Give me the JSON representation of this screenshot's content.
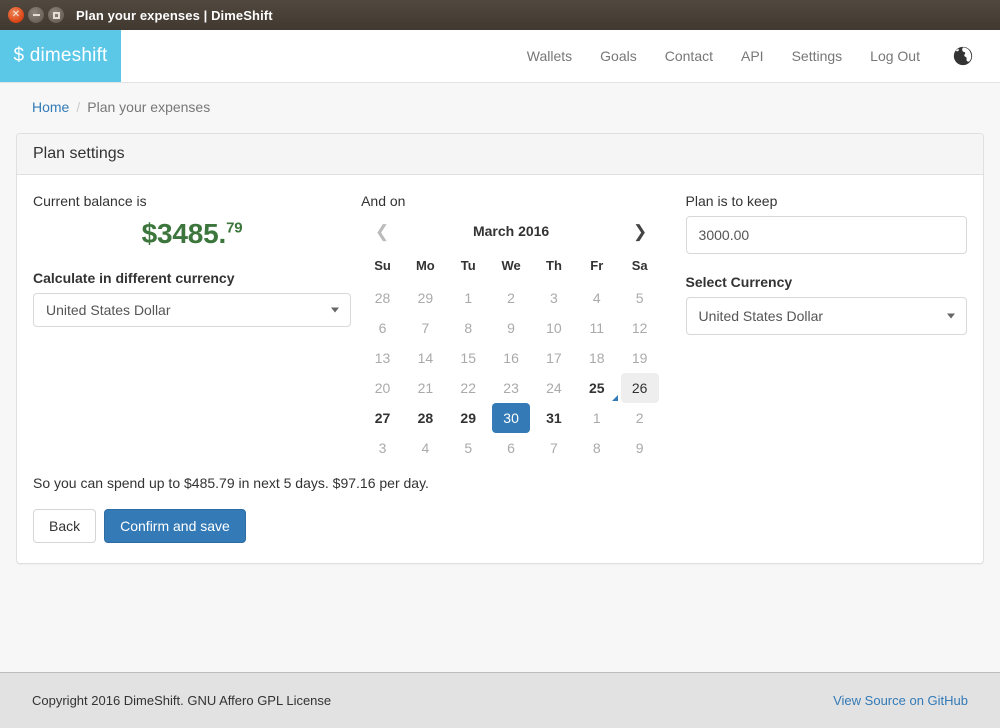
{
  "window": {
    "title": "Plan your expenses | DimeShift",
    "close_icon": "close-icon",
    "minimize_icon": "minimize-icon",
    "maximize-icon": "maximize-icon"
  },
  "navbar": {
    "brand": "$ dimeshift",
    "links": [
      {
        "label": "Wallets"
      },
      {
        "label": "Goals"
      },
      {
        "label": "Contact"
      },
      {
        "label": "API"
      },
      {
        "label": "Settings"
      },
      {
        "label": "Log Out"
      }
    ],
    "globe_icon": "globe-icon"
  },
  "breadcrumb": {
    "home": "Home",
    "separator": "/",
    "current": "Plan your expenses"
  },
  "panel": {
    "heading": "Plan settings",
    "left": {
      "balance_label": "Current balance is",
      "balance_main": "$3485.",
      "balance_cents": "79",
      "currency_label": "Calculate in different currency",
      "currency_value": "United States Dollar"
    },
    "middle": {
      "label": "And on",
      "calendar": {
        "title": "March 2016",
        "prev_icon": "chevron-left-icon",
        "next_icon": "chevron-right-icon",
        "dow": [
          "Su",
          "Mo",
          "Tu",
          "We",
          "Th",
          "Fr",
          "Sa"
        ],
        "weeks": [
          [
            {
              "d": "28",
              "state": "muted"
            },
            {
              "d": "29",
              "state": "muted"
            },
            {
              "d": "1",
              "state": "muted"
            },
            {
              "d": "2",
              "state": "muted"
            },
            {
              "d": "3",
              "state": "muted"
            },
            {
              "d": "4",
              "state": "muted"
            },
            {
              "d": "5",
              "state": "muted"
            }
          ],
          [
            {
              "d": "6",
              "state": "muted"
            },
            {
              "d": "7",
              "state": "muted"
            },
            {
              "d": "8",
              "state": "muted"
            },
            {
              "d": "9",
              "state": "muted"
            },
            {
              "d": "10",
              "state": "muted"
            },
            {
              "d": "11",
              "state": "muted"
            },
            {
              "d": "12",
              "state": "muted"
            }
          ],
          [
            {
              "d": "13",
              "state": "muted"
            },
            {
              "d": "14",
              "state": "muted"
            },
            {
              "d": "15",
              "state": "muted"
            },
            {
              "d": "16",
              "state": "muted"
            },
            {
              "d": "17",
              "state": "muted"
            },
            {
              "d": "18",
              "state": "muted"
            },
            {
              "d": "19",
              "state": "muted"
            }
          ],
          [
            {
              "d": "20",
              "state": "muted"
            },
            {
              "d": "21",
              "state": "muted"
            },
            {
              "d": "22",
              "state": "muted"
            },
            {
              "d": "23",
              "state": "muted"
            },
            {
              "d": "24",
              "state": "muted"
            },
            {
              "d": "25",
              "state": "cur",
              "event": true
            },
            {
              "d": "26",
              "state": "hov"
            }
          ],
          [
            {
              "d": "27",
              "state": "cur"
            },
            {
              "d": "28",
              "state": "cur"
            },
            {
              "d": "29",
              "state": "cur"
            },
            {
              "d": "30",
              "state": "sel"
            },
            {
              "d": "31",
              "state": "cur"
            },
            {
              "d": "1",
              "state": "muted"
            },
            {
              "d": "2",
              "state": "muted"
            }
          ],
          [
            {
              "d": "3",
              "state": "muted"
            },
            {
              "d": "4",
              "state": "muted"
            },
            {
              "d": "5",
              "state": "muted"
            },
            {
              "d": "6",
              "state": "muted"
            },
            {
              "d": "7",
              "state": "muted"
            },
            {
              "d": "8",
              "state": "muted"
            },
            {
              "d": "9",
              "state": "muted"
            }
          ]
        ]
      }
    },
    "right": {
      "keep_label": "Plan is to keep",
      "keep_value": "3000.00",
      "select_currency_label": "Select Currency",
      "select_currency_value": "United States Dollar"
    },
    "summary": "So you can spend up to $485.79 in next 5 days. $97.16 per day.",
    "back_button": "Back",
    "confirm_button": "Confirm and save"
  },
  "footer": {
    "copyright": "Copyright 2016 DimeShift. GNU Affero GPL License",
    "link": "View Source on GitHub"
  },
  "colors": {
    "brand": "#5bc8e8",
    "primary": "#337ab7",
    "balance_green": "#3c763d",
    "link": "#337ab7"
  }
}
